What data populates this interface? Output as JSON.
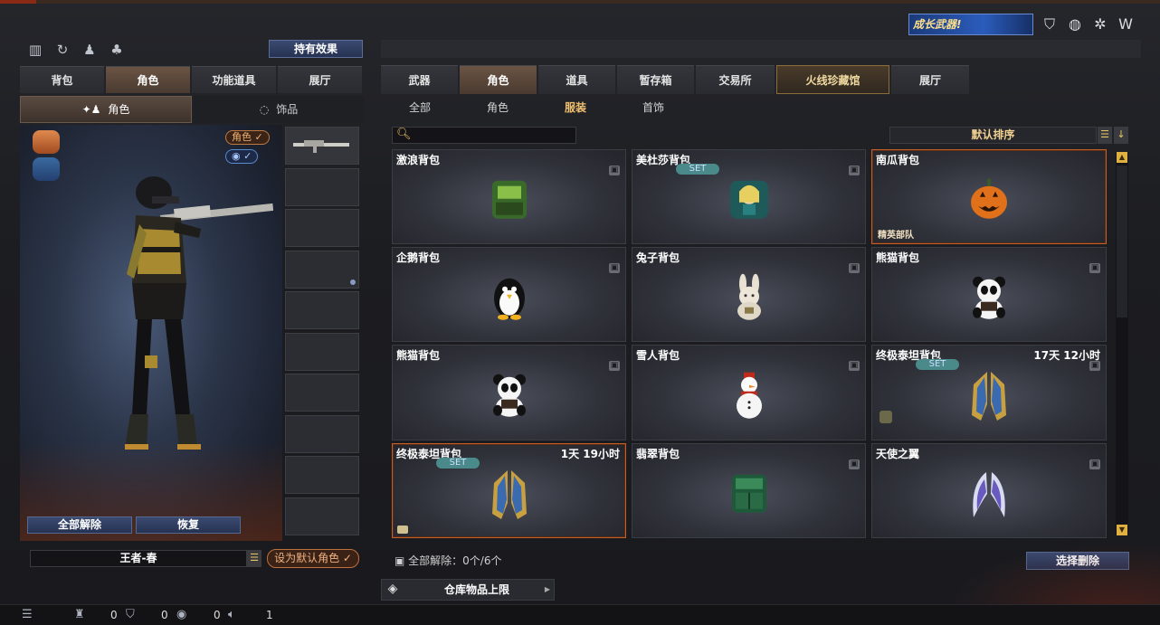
{
  "top": {
    "effects_button": "持有效果",
    "promo_text": "成长武器!"
  },
  "left_tabs": [
    {
      "label": "背包",
      "active": false
    },
    {
      "label": "角色",
      "active": true
    },
    {
      "label": "功能道具",
      "active": false
    },
    {
      "label": "展厅",
      "active": false
    }
  ],
  "left_subtabs": [
    {
      "label": "角色",
      "active": true
    },
    {
      "label": "饰品",
      "active": false
    }
  ],
  "character": {
    "role_pill": "角色 ✓",
    "eye_pill": "◉ ✓",
    "unequip_all": "全部解除",
    "restore": "恢复",
    "name": "王者-春",
    "set_default": "设为默认角色 ✓"
  },
  "right_tabs": [
    {
      "label": "武器",
      "active": false
    },
    {
      "label": "角色",
      "active": true
    },
    {
      "label": "道具",
      "active": false
    },
    {
      "label": "暂存箱",
      "active": false
    },
    {
      "label": "交易所",
      "active": false
    },
    {
      "label": "火线珍藏馆",
      "active": false,
      "gold": true
    },
    {
      "label": "展厅",
      "active": false
    }
  ],
  "categories": [
    {
      "label": "全部",
      "active": false
    },
    {
      "label": "角色",
      "active": false
    },
    {
      "label": "服装",
      "active": true
    },
    {
      "label": "首饰",
      "active": false
    }
  ],
  "search": {
    "placeholder": ""
  },
  "sort": {
    "label": "默认排序"
  },
  "items": [
    {
      "name": "激浪背包",
      "icon": "green-backpack"
    },
    {
      "name": "美杜莎背包",
      "icon": "medusa-backpack",
      "set": "SET"
    },
    {
      "name": "南瓜背包",
      "icon": "pumpkin",
      "selected": true,
      "tag": "精英部队"
    },
    {
      "name": "企鹅背包",
      "icon": "penguin"
    },
    {
      "name": "兔子背包",
      "icon": "rabbit"
    },
    {
      "name": "熊猫背包",
      "icon": "panda"
    },
    {
      "name": "熊猫背包",
      "icon": "panda"
    },
    {
      "name": "雪人背包",
      "icon": "snowman"
    },
    {
      "name": "终极泰坦背包",
      "icon": "titan-wings",
      "set": "SET",
      "timer": "17天 12小时"
    },
    {
      "name": "终极泰坦背包",
      "icon": "titan-wings",
      "set": "SET",
      "timer": "1天 19小时",
      "selected": true
    },
    {
      "name": "翡翠背包",
      "icon": "jade-backpack"
    },
    {
      "name": "天使之翼",
      "icon": "angel-wings"
    }
  ],
  "footer": {
    "unequip_status": "全部解除：0个/6个",
    "select_delete": "选择删除",
    "warehouse": "仓库物品上限"
  },
  "status_bar": {
    "a": "0",
    "b": "0",
    "c": "0",
    "d": "1"
  }
}
